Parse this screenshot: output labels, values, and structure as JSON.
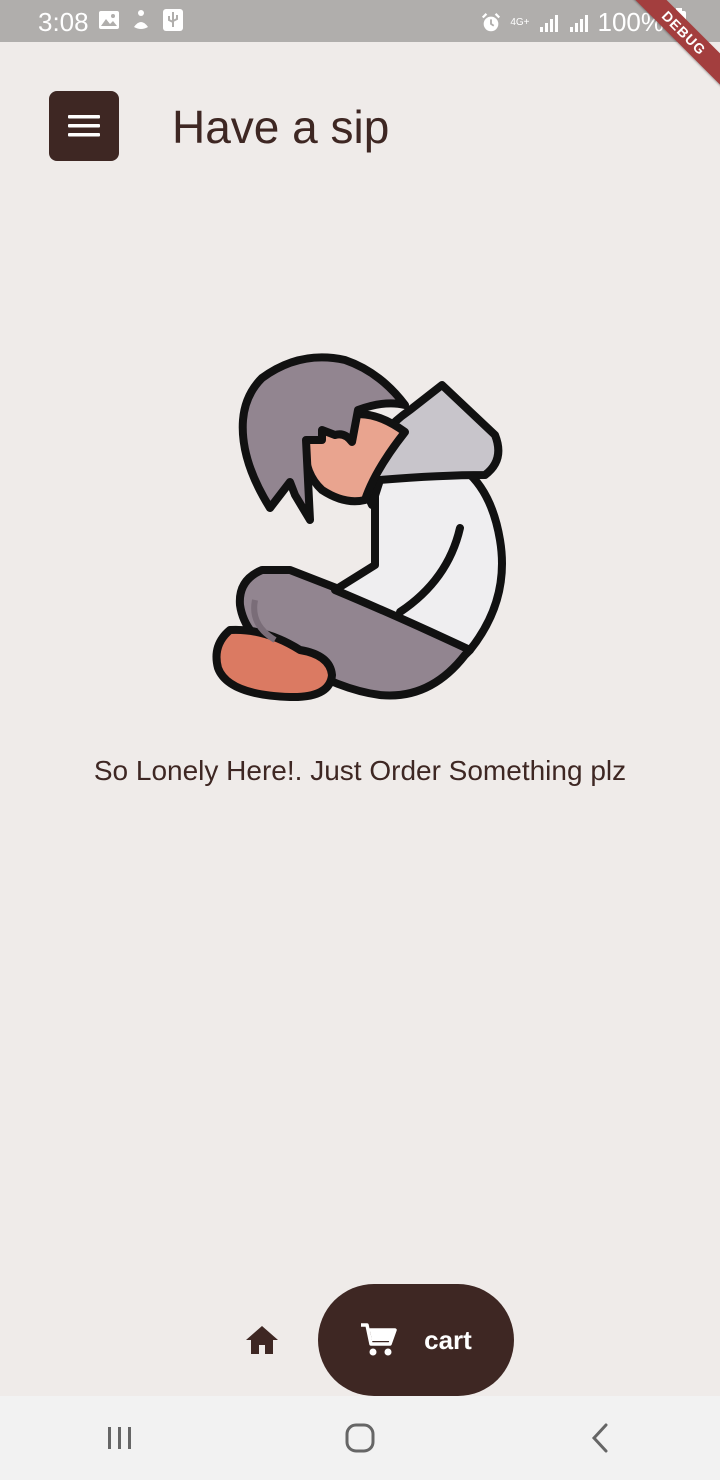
{
  "status_bar": {
    "time": "3:08",
    "battery": "100%",
    "network": "4G+",
    "icons": [
      "image-icon",
      "accessibility-icon",
      "usb-icon",
      "alarm-icon",
      "signal-icon",
      "signal-icon",
      "battery-icon"
    ]
  },
  "debug_banner": "DEBUG",
  "app_bar": {
    "title": "Have a sip",
    "menu_icon": "menu-icon"
  },
  "empty_state": {
    "illustration": "lonely-person-illustration",
    "message": "So Lonely Here!. Just Order Something plz"
  },
  "bottom_nav": {
    "home_icon": "home-icon",
    "cart_icon": "cart-icon",
    "cart_label": "cart",
    "selected": "cart"
  },
  "system_nav": {
    "buttons": [
      "recent-apps-icon",
      "home-circle-icon",
      "back-icon"
    ]
  },
  "colors": {
    "background": "#efebe9",
    "primary": "#3e2723",
    "status_bar": "#b0aeac",
    "system_nav": "#f2f2f2"
  }
}
